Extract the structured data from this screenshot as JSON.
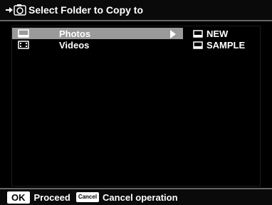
{
  "header": {
    "title": "Select Folder to Copy to",
    "icon": "copy-to-camera-icon"
  },
  "folders": {
    "items": [
      {
        "label": "Photos",
        "icon": "photo-folder-icon",
        "selected": true
      },
      {
        "label": "Videos",
        "icon": "video-folder-icon",
        "selected": false
      }
    ],
    "subfolders": [
      {
        "label": "NEW",
        "icon": "folder-icon"
      },
      {
        "label": "SAMPLE",
        "icon": "folder-icon"
      }
    ]
  },
  "footer": {
    "ok_button": "OK",
    "ok_label": "Proceed",
    "cancel_button": "Cancel",
    "cancel_label": "Cancel operation"
  },
  "colors": {
    "selection": "#9a9a9a",
    "background": "#000000",
    "text": "#ffffff"
  }
}
